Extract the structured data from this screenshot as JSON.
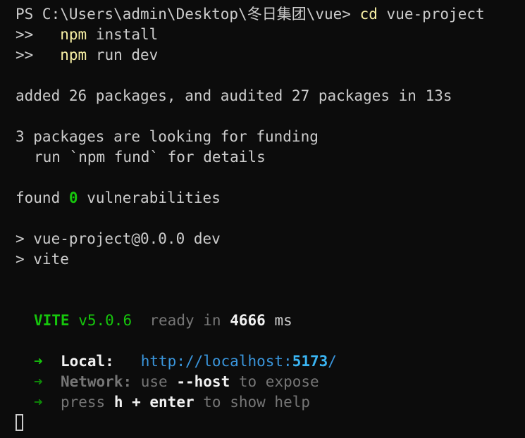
{
  "terminal": {
    "prompt": "PS C:\\Users\\admin\\Desktop\\冬日集团\\vue>",
    "cmd1_keyword": "cd",
    "cmd1_args": "vue-project",
    "continuation_marker": ">>",
    "cmd2_keyword": "npm",
    "cmd2_args": "install",
    "cmd3_keyword": "npm",
    "cmd3_args": "run dev",
    "added_line": "added 26 packages, and audited 27 packages in 13s",
    "funding_line1": "3 packages are looking for funding",
    "funding_line2": "run `npm fund` for details",
    "found_prefix": "found",
    "found_count": "0",
    "found_suffix": "vulnerabilities",
    "script_line1": "> vue-project@0.0.0 dev",
    "script_line2": "> vite",
    "vite_name": "VITE",
    "vite_version": "v5.0.6",
    "vite_ready": "ready in",
    "vite_ms_value": "4666",
    "vite_ms_unit": "ms",
    "arrow": "➜",
    "local_label": "Local:",
    "local_url_prefix": "http://localhost:",
    "local_url_port": "5173",
    "local_url_suffix": "/",
    "network_label": "Network:",
    "network_use": "use",
    "network_flag": "--host",
    "network_rest": "to expose",
    "help_press": "press",
    "help_key": "h + enter",
    "help_rest": "to show help"
  },
  "colors": {
    "background": "#0c0c0c",
    "foreground": "#cccccc",
    "command_yellow": "#f9f1a5",
    "success_green": "#16c60c",
    "url_cyan": "#3a96dd",
    "dim_gray": "#767676"
  }
}
